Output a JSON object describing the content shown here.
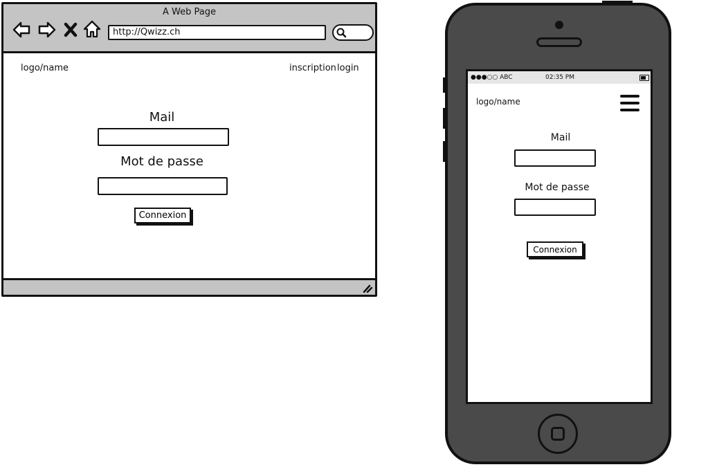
{
  "browser": {
    "window_title": "A Web Page",
    "url": "http://Qwizz.ch",
    "toolbar_icons": [
      "back-icon",
      "forward-icon",
      "close-icon",
      "home-icon",
      "search-icon"
    ],
    "header": {
      "logo": "logo/name",
      "nav": {
        "inscription": "inscription",
        "login": "login"
      }
    },
    "form": {
      "mail_label": "Mail",
      "mail_value": "",
      "password_label": "Mot de passe",
      "password_value": "",
      "submit_label": "Connexion"
    }
  },
  "phone": {
    "status": {
      "carrier": "●●●○○ ABC",
      "time": "02:35 PM",
      "battery_icon": "battery-icon"
    },
    "header": {
      "logo": "logo/name",
      "menu_icon": "hamburger-menu-icon"
    },
    "form": {
      "mail_label": "Mail",
      "mail_value": "",
      "password_label": "Mot de passe",
      "password_value": "",
      "submit_label": "Connexion"
    }
  },
  "colors": {
    "chrome_gray": "#c4c4c4",
    "phone_body": "#4a4a4a",
    "ink": "#111111",
    "phone_status_bg": "#e6e6e6"
  }
}
